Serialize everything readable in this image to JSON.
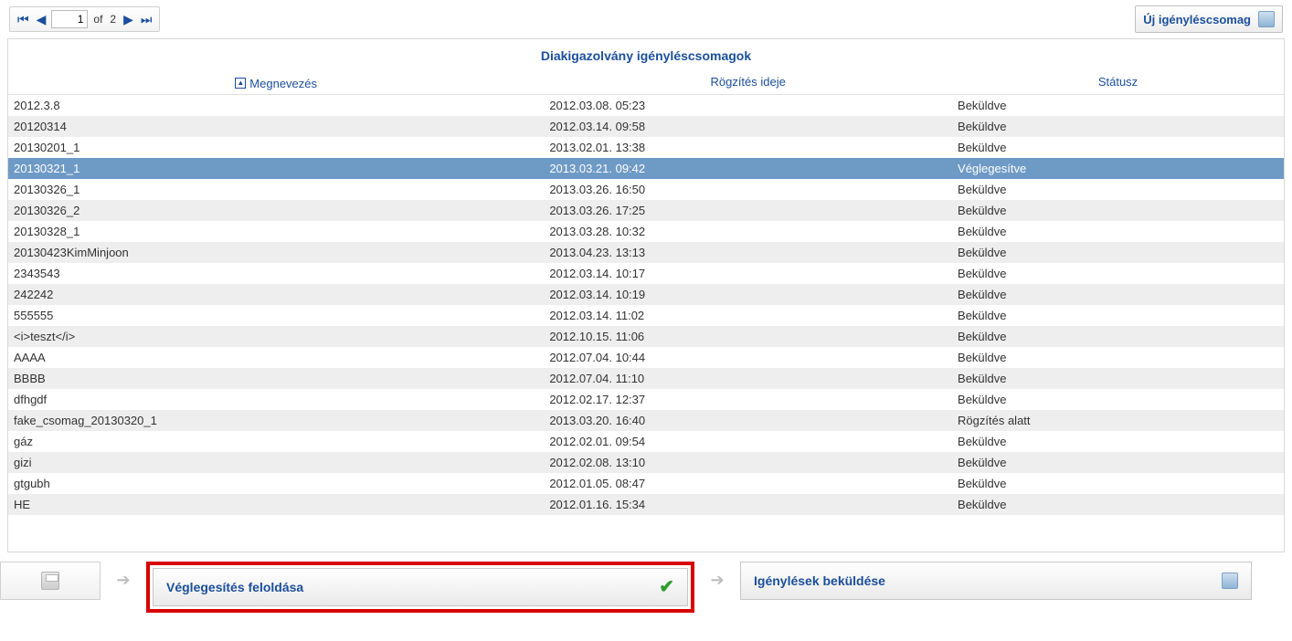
{
  "pager": {
    "page": "1",
    "of_label": "of",
    "total": "2"
  },
  "new_package_label": "Új igényléscsomag",
  "panel_title": "Diakigazolvány igényléscsomagok",
  "columns": {
    "name": "Megnevezés",
    "time": "Rögzítés ideje",
    "status": "Státusz"
  },
  "selected_index": 3,
  "rows": [
    {
      "name": "2012.3.8",
      "time": "2012.03.08. 05:23",
      "status": "Beküldve"
    },
    {
      "name": "20120314",
      "time": "2012.03.14. 09:58",
      "status": "Beküldve"
    },
    {
      "name": "20130201_1",
      "time": "2013.02.01. 13:38",
      "status": "Beküldve"
    },
    {
      "name": "20130321_1",
      "time": "2013.03.21. 09:42",
      "status": "Véglegesítve"
    },
    {
      "name": "20130326_1",
      "time": "2013.03.26. 16:50",
      "status": "Beküldve"
    },
    {
      "name": "20130326_2",
      "time": "2013.03.26. 17:25",
      "status": "Beküldve"
    },
    {
      "name": "20130328_1",
      "time": "2013.03.28. 10:32",
      "status": "Beküldve"
    },
    {
      "name": "20130423KimMinjoon",
      "time": "2013.04.23. 13:13",
      "status": "Beküldve"
    },
    {
      "name": "2343543",
      "time": "2012.03.14. 10:17",
      "status": "Beküldve"
    },
    {
      "name": "242242",
      "time": "2012.03.14. 10:19",
      "status": "Beküldve"
    },
    {
      "name": "555555",
      "time": "2012.03.14. 11:02",
      "status": "Beküldve"
    },
    {
      "name": "<i>teszt</i>",
      "time": "2012.10.15. 11:06",
      "status": "Beküldve"
    },
    {
      "name": "AAAA",
      "time": "2012.07.04. 10:44",
      "status": "Beküldve"
    },
    {
      "name": "BBBB",
      "time": "2012.07.04. 11:10",
      "status": "Beküldve"
    },
    {
      "name": "dfhgdf",
      "time": "2012.02.17. 12:37",
      "status": "Beküldve"
    },
    {
      "name": "fake_csomag_20130320_1",
      "time": "2013.03.20. 16:40",
      "status": "Rögzítés alatt"
    },
    {
      "name": "gáz",
      "time": "2012.02.01. 09:54",
      "status": "Beküldve"
    },
    {
      "name": "gizi",
      "time": "2012.02.08. 13:10",
      "status": "Beküldve"
    },
    {
      "name": "gtgubh",
      "time": "2012.01.05. 08:47",
      "status": "Beküldve"
    },
    {
      "name": "HE",
      "time": "2012.01.16. 15:34",
      "status": "Beküldve"
    }
  ],
  "actions": {
    "unlock": "Véglegesítés feloldása",
    "send": "Igénylések beküldése"
  }
}
